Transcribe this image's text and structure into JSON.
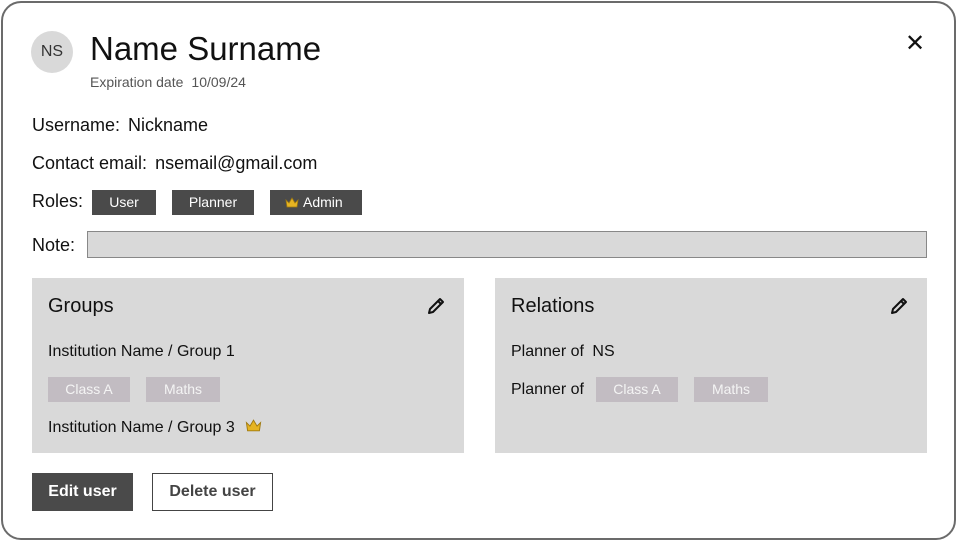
{
  "header": {
    "avatar_initials": "NS",
    "name": "Name Surname",
    "expiration_label": "Expiration date",
    "expiration_value": "10/09/24",
    "close_icon": "close-icon"
  },
  "fields": {
    "username_label": "Username:",
    "username_value": "Nickname",
    "email_label": "Contact email:",
    "email_value": "nsemail@gmail.com",
    "roles_label": "Roles:",
    "roles": [
      "User",
      "Planner",
      "Admin"
    ],
    "admin_icon": "crown-icon",
    "note_label": "Note:",
    "note_value": ""
  },
  "groups": {
    "title": "Groups",
    "items": [
      {
        "name": "Institution Name / Group 1",
        "tags": [
          "Class A",
          "Maths"
        ]
      },
      {
        "name": "Institution Name / Group 3",
        "icon": "crown-icon"
      }
    ]
  },
  "relations": {
    "title": "Relations",
    "items": [
      {
        "label": "Planner of",
        "value": "NS"
      },
      {
        "label": "Planner of",
        "tags": [
          "Class A",
          "Maths"
        ]
      }
    ]
  },
  "actions": {
    "edit_label": "Edit user",
    "delete_label": "Delete user"
  },
  "colors": {
    "chip_dark": "#4a4a4a",
    "panel_bg": "#d9d9d9",
    "tag_bg": "#c2bcc2",
    "crown": "#e6b422"
  }
}
